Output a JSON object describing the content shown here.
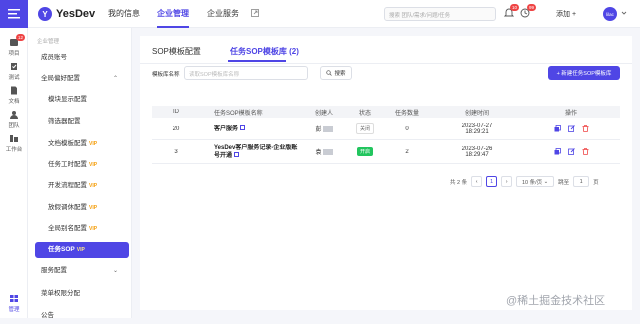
{
  "rail": {
    "badge": "12",
    "items": [
      "项目",
      "测试",
      "文档",
      "团队",
      "工作台",
      "管理"
    ]
  },
  "header": {
    "brand": "YesDev",
    "nav": [
      "我的信息",
      "企业管理",
      "企业服务"
    ],
    "active_nav": "企业管理",
    "search_placeholder": "搜索 团队/需求/问题/任务",
    "notify_badge": "10",
    "timer_badge": "99",
    "add_label": "添加 +",
    "avatar": "lilac"
  },
  "sidebar": {
    "section_title": "企业管理",
    "items": [
      {
        "label": "成员账号",
        "sub": false
      },
      {
        "label": "全局偏好配置",
        "sub": false,
        "expand": "⌃"
      },
      {
        "label": "模块显示配置",
        "sub": true
      },
      {
        "label": "筛选器配置",
        "sub": true
      },
      {
        "label": "文档模板配置",
        "sub": true,
        "vip": "VIP"
      },
      {
        "label": "任务工时配置",
        "sub": true,
        "vip": "VIP"
      },
      {
        "label": "开发流程配置",
        "sub": true,
        "vip": "VIP"
      },
      {
        "label": "放假调休配置",
        "sub": true,
        "vip": "VIP"
      },
      {
        "label": "全局别名配置",
        "sub": true,
        "vip": "VIP"
      },
      {
        "label": "任务SOP",
        "sub": true,
        "vip": "VIP",
        "active": true
      },
      {
        "label": "服务配置",
        "sub": false,
        "expand": "⌄"
      },
      {
        "label": "菜单权限分配",
        "sub": false
      },
      {
        "label": "公告",
        "sub": false
      }
    ]
  },
  "tabs": [
    "SOP模板配置",
    "任务SOP模板库 (2)"
  ],
  "filter": {
    "label": "模板库名称",
    "placeholder": "读取SOP模板库名称",
    "search_button": "搜索",
    "new_button": "+ 新建任务SOP模板库"
  },
  "table": {
    "headers": [
      "ID",
      "任务SOP模板名称",
      "创建人",
      "状态",
      "任务数量",
      "创建时间",
      "操作"
    ],
    "rows": [
      {
        "id": "20",
        "name": "客户服务",
        "creator": "彭",
        "status": "关闭",
        "status_on": false,
        "count": "0",
        "date": "2023-07-27",
        "time": "18:29:21"
      },
      {
        "id": "3",
        "name": "YesDev客户服务记录-企业版账号开通",
        "creator": "袁",
        "status": "开启",
        "status_on": true,
        "count": "2",
        "date": "2023-07-26",
        "time": "18:29:47"
      }
    ]
  },
  "pager": {
    "total": "共 2 条",
    "current": "1",
    "page_size": "10 条/页",
    "jump_label": "跳至",
    "jump_value": "1",
    "page_suffix": "页"
  },
  "watermark": "@稀土掘金技术社区",
  "colors": {
    "accent": "#4f46e5",
    "on": "#22c55e",
    "danger": "#ef4444",
    "vip": "#f59e0b"
  }
}
